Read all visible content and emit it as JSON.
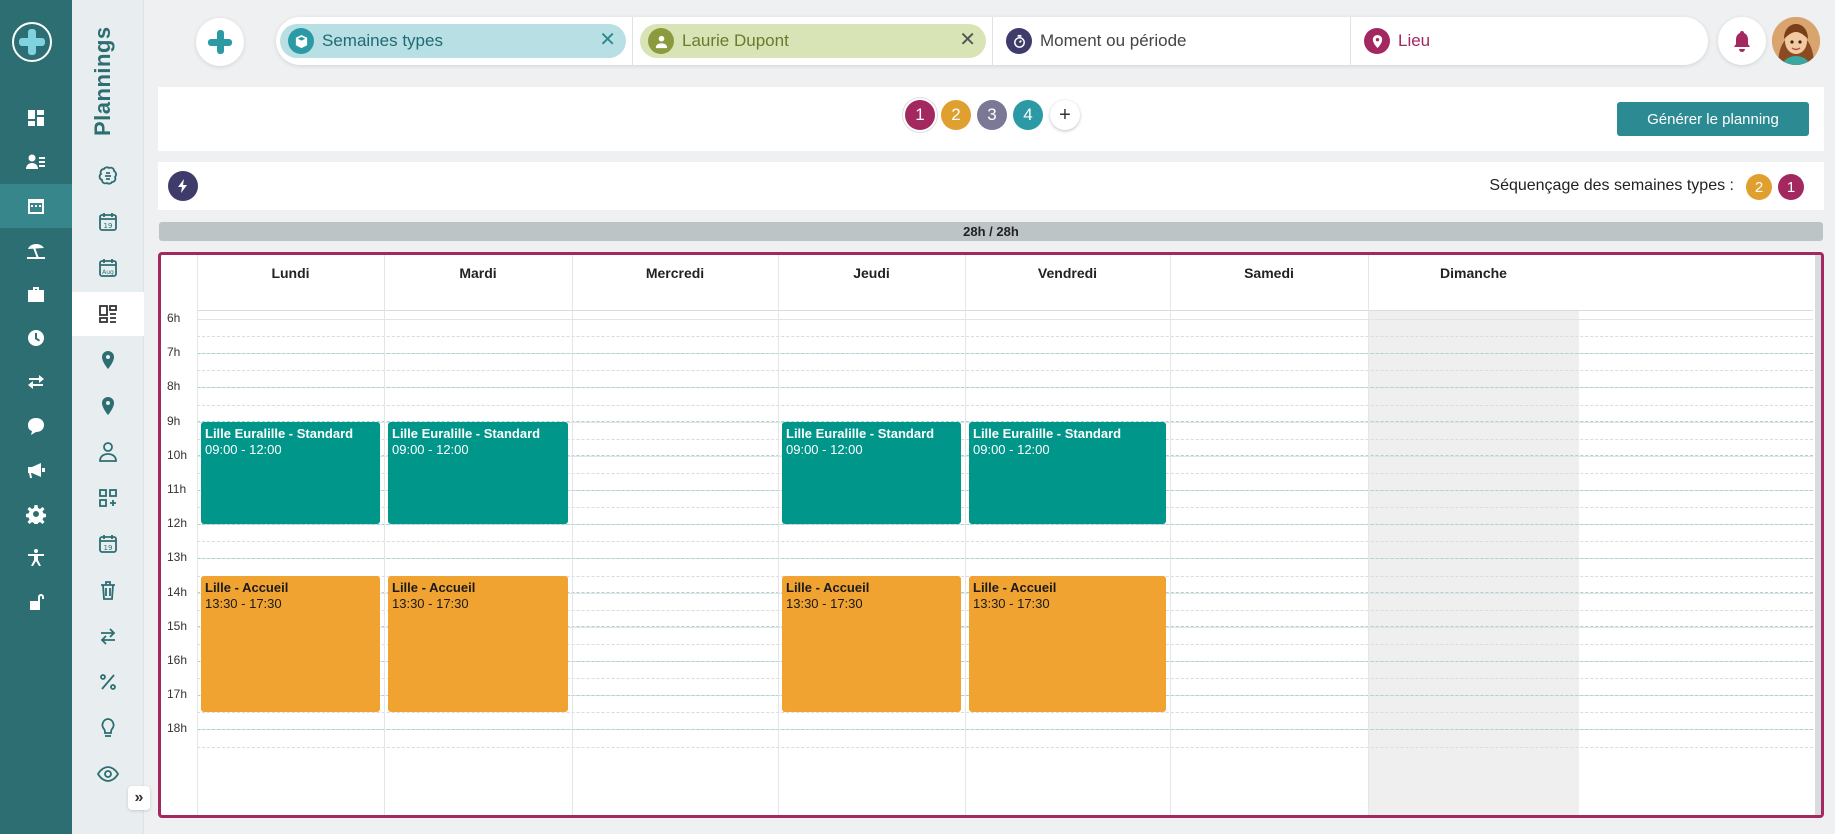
{
  "sidebar": {
    "title": "Plannings",
    "expand": "»"
  },
  "filters": {
    "chip1": {
      "label": "Semaines types",
      "icon": "cube-icon"
    },
    "chip2": {
      "label": "Laurie Dupont",
      "icon": "user-icon"
    },
    "moment": {
      "label": "Moment ou période",
      "icon": "timer-icon"
    },
    "lieu": {
      "label": "Lieu",
      "icon": "location-pin-icon"
    },
    "clear": "✕"
  },
  "weeks": {
    "items": [
      {
        "label": "1",
        "color": "#a3285f"
      },
      {
        "label": "2",
        "color": "#e0a030"
      },
      {
        "label": "3",
        "color": "#7a7894"
      },
      {
        "label": "4",
        "color": "#2c9aa5"
      }
    ],
    "add": "+"
  },
  "actions": {
    "generate": "Générer le planning"
  },
  "sequencing": {
    "label": "Séquençage des semaines types :",
    "badges": [
      {
        "label": "2",
        "color": "#e0a030"
      },
      {
        "label": "1",
        "color": "#a3285f"
      }
    ]
  },
  "hours_summary": "28h / 28h",
  "calendar": {
    "days": [
      "Lundi",
      "Mardi",
      "Mercredi",
      "Jeudi",
      "Vendredi",
      "Samedi",
      "Dimanche"
    ],
    "hours": [
      "6h",
      "7h",
      "8h",
      "9h",
      "10h",
      "11h",
      "12h",
      "13h",
      "14h",
      "15h",
      "16h",
      "17h",
      "18h"
    ],
    "events": [
      {
        "day": "Lundi",
        "title": "Lille Euralille - Standard",
        "time": "09:00 - 12:00",
        "color": "#00968a"
      },
      {
        "day": "Mardi",
        "title": "Lille Euralille - Standard",
        "time": "09:00 - 12:00",
        "color": "#00968a"
      },
      {
        "day": "Jeudi",
        "title": "Lille Euralille - Standard",
        "time": "09:00 - 12:00",
        "color": "#00968a"
      },
      {
        "day": "Vendredi",
        "title": "Lille Euralille - Standard",
        "time": "09:00 - 12:00",
        "color": "#00968a"
      },
      {
        "day": "Lundi",
        "title": "Lille - Accueil",
        "time": "13:30 - 17:30",
        "color": "#f0a330"
      },
      {
        "day": "Mardi",
        "title": "Lille - Accueil",
        "time": "13:30 - 17:30",
        "color": "#f0a330"
      },
      {
        "day": "Jeudi",
        "title": "Lille - Accueil",
        "time": "13:30 - 17:30",
        "color": "#f0a330"
      },
      {
        "day": "Vendredi",
        "title": "Lille - Accueil",
        "time": "13:30 - 17:30",
        "color": "#f0a330"
      }
    ]
  },
  "colors": {
    "primary": "#2c6e72",
    "accent": "#a3285f",
    "teal_event": "#00968a",
    "orange_event": "#f0a330"
  }
}
